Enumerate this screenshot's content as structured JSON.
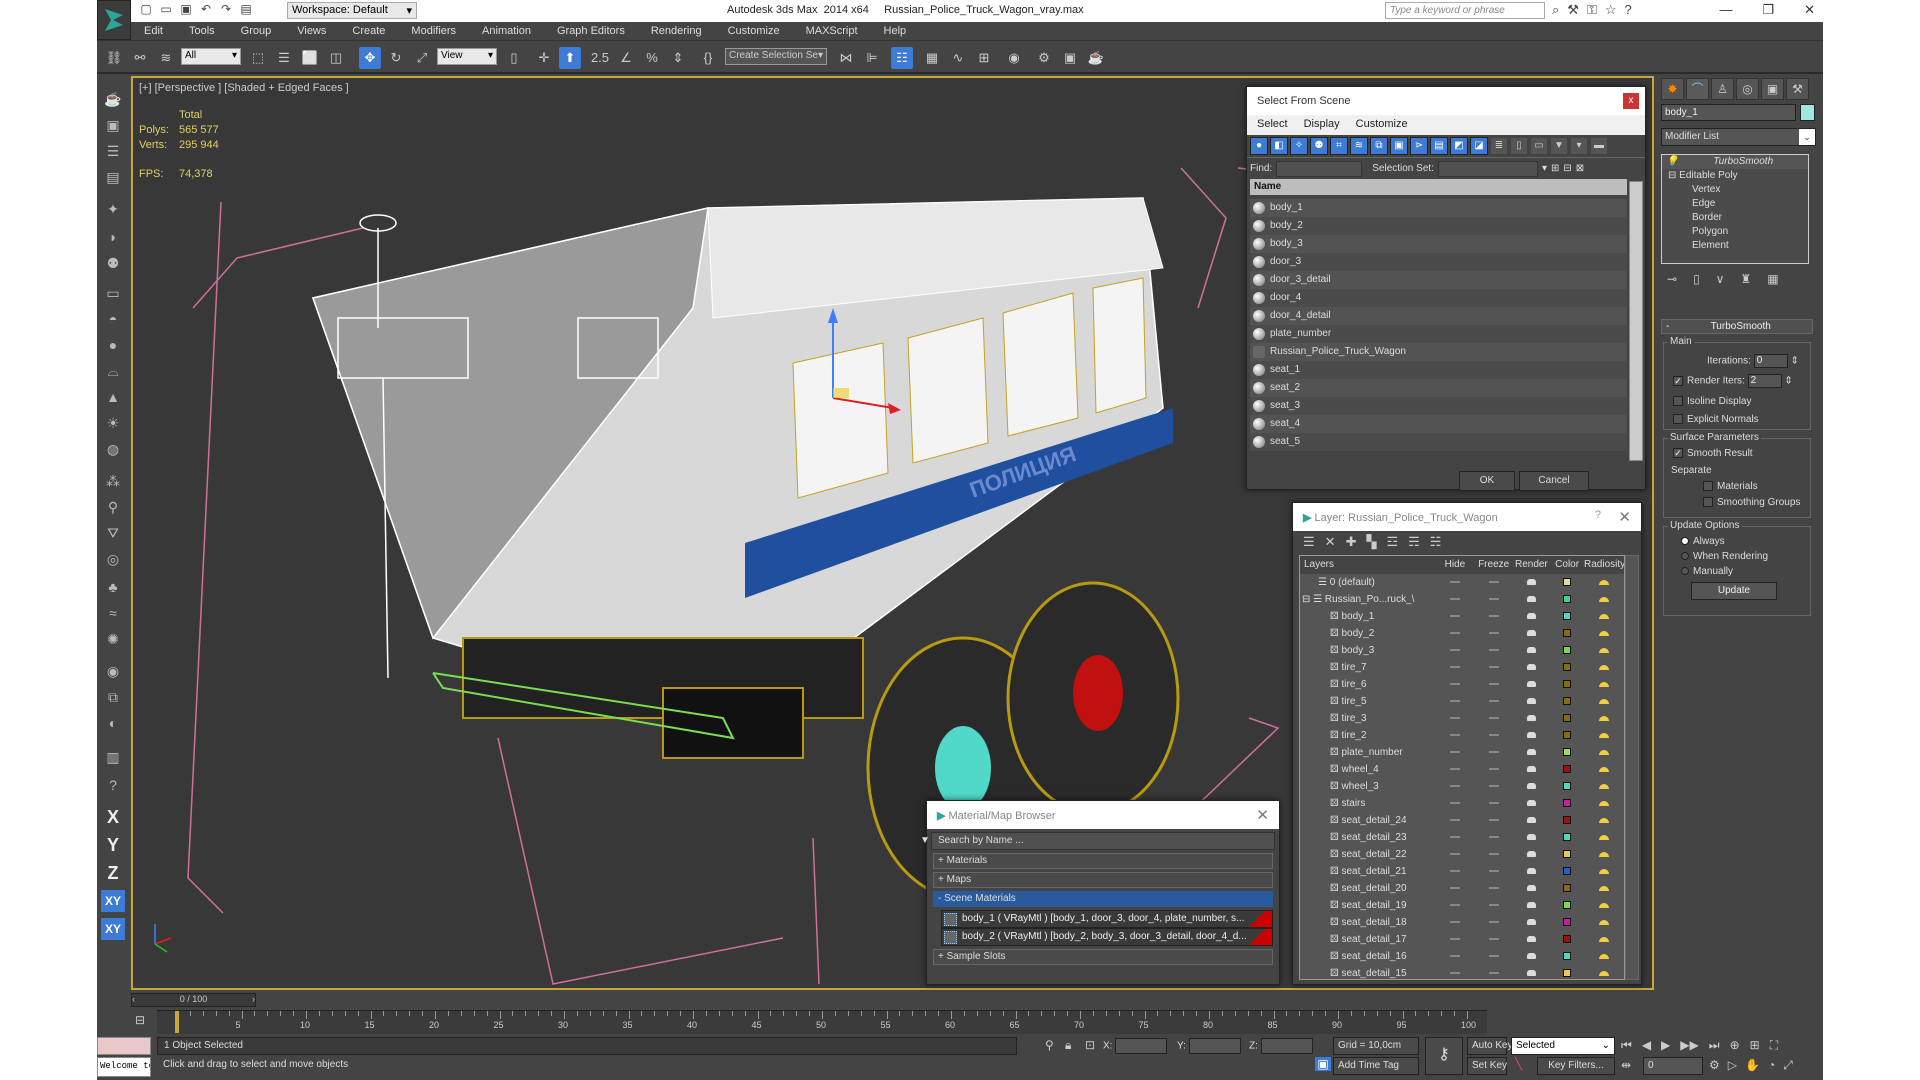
{
  "titlebar": {
    "app_title": "Autodesk 3ds Max  2014 x64",
    "file_name": "Russian_Police_Truck_Wagon_vray.max",
    "workspace": "Workspace: Default",
    "search_placeholder": "Type a keyword or phrase"
  },
  "menu": [
    "Edit",
    "Tools",
    "Group",
    "Views",
    "Create",
    "Modifiers",
    "Animation",
    "Graph Editors",
    "Rendering",
    "Customize",
    "MAXScript",
    "Help"
  ],
  "toolbar": {
    "selection_filter": "All",
    "ref_coord": "View",
    "snap_value": "2.5",
    "named_selection_placeholder": "Create Selection Se"
  },
  "viewport": {
    "label": "[+] [Perspective ] [Shaded + Edged Faces ]",
    "stats_header": "Total",
    "polys_label": "Polys:",
    "polys": "565 577",
    "verts_label": "Verts:",
    "verts": "295 944",
    "fps_label": "FPS:",
    "fps": "74,378",
    "stripe_text": "ПОЛИЦИЯ"
  },
  "left_strip": {
    "axis_x": "X",
    "axis_y": "Y",
    "axis_z": "Z",
    "axis_xy": "XY",
    "axis_xy2": "XY"
  },
  "command_panel": {
    "object_name": "body_1",
    "object_color": "#9ee8dc",
    "modifier_list": "Modifier List",
    "stack": [
      "TurboSmooth",
      "Editable Poly",
      "Vertex",
      "Edge",
      "Border",
      "Polygon",
      "Element"
    ],
    "rollout_title": "TurboSmooth",
    "main_group": "Main",
    "iterations_label": "Iterations:",
    "iterations": "0",
    "render_iters_label": "Render Iters:",
    "render_iters": "2",
    "render_iters_checked": true,
    "isoline_label": "Isoline Display",
    "explicit_normals_label": "Explicit Normals",
    "surface_group": "Surface Parameters",
    "smooth_result_label": "Smooth Result",
    "separate_label": "Separate",
    "materials_label": "Materials",
    "smoothing_groups_label": "Smoothing Groups",
    "update_group": "Update Options",
    "update_always": "Always",
    "update_rendering": "When Rendering",
    "update_manually": "Manually",
    "update_button": "Update"
  },
  "select_from_scene": {
    "title": "Select From Scene",
    "close": "x",
    "menu": [
      "Select",
      "Display",
      "Customize"
    ],
    "find_label": "Find:",
    "selection_set_label": "Selection Set:",
    "column_name": "Name",
    "items": [
      {
        "name": "body_1",
        "type": "geometry"
      },
      {
        "name": "body_2",
        "type": "geometry"
      },
      {
        "name": "body_3",
        "type": "geometry"
      },
      {
        "name": "door_3",
        "type": "geometry"
      },
      {
        "name": "door_3_detail",
        "type": "geometry"
      },
      {
        "name": "door_4",
        "type": "geometry"
      },
      {
        "name": "door_4_detail",
        "type": "geometry"
      },
      {
        "name": "plate_number",
        "type": "geometry"
      },
      {
        "name": "Russian_Police_Truck_Wagon",
        "type": "group"
      },
      {
        "name": "seat_1",
        "type": "geometry"
      },
      {
        "name": "seat_2",
        "type": "geometry"
      },
      {
        "name": "seat_3",
        "type": "geometry"
      },
      {
        "name": "seat_4",
        "type": "geometry"
      },
      {
        "name": "seat_5",
        "type": "geometry"
      }
    ],
    "ok": "OK",
    "cancel": "Cancel"
  },
  "layer_dialog": {
    "title": "Layer: Russian_Police_Truck_Wagon",
    "help": "?",
    "close": "✕",
    "columns": [
      "Layers",
      "Hide",
      "Freeze",
      "Render",
      "Color",
      "Radiosity"
    ],
    "rows": [
      {
        "name": "0 (default)",
        "kind": "layer",
        "color": "#e8d89a"
      },
      {
        "name": "Russian_Po...ruck_\\",
        "kind": "layer-open",
        "color": "#3fd68a"
      },
      {
        "name": "body_1",
        "kind": "object",
        "color": "#4fd8c0"
      },
      {
        "name": "body_2",
        "kind": "object",
        "color": "#8a6a10"
      },
      {
        "name": "body_3",
        "kind": "object",
        "color": "#7ad850"
      },
      {
        "name": "tire_7",
        "kind": "object",
        "color": "#8a6a10"
      },
      {
        "name": "tire_6",
        "kind": "object",
        "color": "#8a6a10"
      },
      {
        "name": "tire_5",
        "kind": "object",
        "color": "#8a6a10"
      },
      {
        "name": "tire_3",
        "kind": "object",
        "color": "#8a6a10"
      },
      {
        "name": "tire_2",
        "kind": "object",
        "color": "#8a6a10"
      },
      {
        "name": "plate_number",
        "kind": "object",
        "color": "#a0e050"
      },
      {
        "name": "wheel_4",
        "kind": "object",
        "color": "#a01010"
      },
      {
        "name": "wheel_3",
        "kind": "object",
        "color": "#4fd8c0"
      },
      {
        "name": "stairs",
        "kind": "object",
        "color": "#c020a0"
      },
      {
        "name": "seat_detail_24",
        "kind": "object",
        "color": "#a01010"
      },
      {
        "name": "seat_detail_23",
        "kind": "object",
        "color": "#4fd8c0"
      },
      {
        "name": "seat_detail_22",
        "kind": "object",
        "color": "#e8c860"
      },
      {
        "name": "seat_detail_21",
        "kind": "object",
        "color": "#2060c0"
      },
      {
        "name": "seat_detail_20",
        "kind": "object",
        "color": "#8a6a10"
      },
      {
        "name": "seat_detail_19",
        "kind": "object",
        "color": "#7ad850"
      },
      {
        "name": "seat_detail_18",
        "kind": "object",
        "color": "#c020a0"
      },
      {
        "name": "seat_detail_17",
        "kind": "object",
        "color": "#a01010"
      },
      {
        "name": "seat_detail_16",
        "kind": "object",
        "color": "#4fd8c0"
      },
      {
        "name": "seat_detail_15",
        "kind": "object",
        "color": "#e8c860"
      }
    ]
  },
  "material_browser": {
    "title": "Material/Map Browser",
    "search_placeholder": "Search by Name ...",
    "sections": {
      "materials": "+ Materials",
      "maps": "+ Maps",
      "scene_materials": "- Scene Materials",
      "sample_slots": "+ Sample Slots"
    },
    "scene_items": [
      "body_1  ( VRayMtl ) [body_1, door_3, door_4, plate_number, s...",
      "body_2  ( VRayMtl ) [body_2, body_3, door_3_detail, door_4_d..."
    ]
  },
  "timeline": {
    "frame": "0 / 100",
    "ticks": [
      "5",
      "10",
      "15",
      "20",
      "25",
      "30",
      "35",
      "40",
      "45",
      "50",
      "55",
      "60",
      "65",
      "70",
      "75",
      "80",
      "85",
      "90",
      "95",
      "100"
    ]
  },
  "status": {
    "maxscript_line": "Welcome to M",
    "selected": "1 Object Selected",
    "prompt": "Click and drag to select and move objects",
    "x_label": "X:",
    "y_label": "Y:",
    "z_label": "Z:",
    "grid": "Grid = 10,0cm",
    "add_time_tag": "Add Time Tag",
    "auto_key": "Auto Key",
    "set_key": "Set Key",
    "key_mode": "Selected",
    "key_filters": "Key Filters...",
    "current_frame": "0"
  },
  "colors": {
    "accent_blue": "#3d7bd6",
    "viewport_border": "#c8a63a",
    "bbox_pink": "#d0709a",
    "wire_yellow": "#b89a10"
  }
}
